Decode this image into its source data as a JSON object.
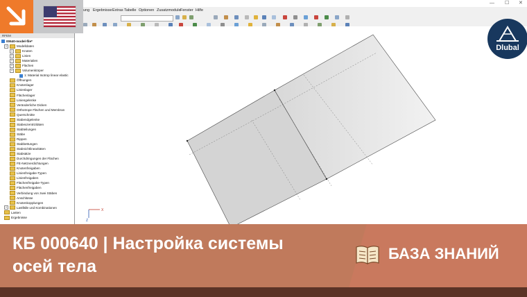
{
  "menu": [
    "ung",
    "Ergebnisse",
    "Extras",
    "Tabelle",
    "Optionen",
    "Zusatzmodule",
    "Fenster",
    "Hilfe"
  ],
  "window_controls": {
    "minimize": "—",
    "maximize": "☐",
    "close": "✕"
  },
  "navigator": {
    "header": "RFEM",
    "model": "00640-model-file*",
    "items": [
      {
        "label": "Modelldaten",
        "level": 1,
        "expand": true
      },
      {
        "label": "Knoten",
        "level": 2,
        "expand": true
      },
      {
        "label": "Linien",
        "level": 2,
        "expand": true
      },
      {
        "label": "Materialien",
        "level": 2,
        "expand": true
      },
      {
        "label": "Flächen",
        "level": 2,
        "expand": true
      },
      {
        "label": "Volumenkörper",
        "level": 2,
        "expand": true
      },
      {
        "label": "1: Material Isotrop linear elastic",
        "level": 3,
        "expand": false,
        "model": true
      },
      {
        "label": "Öffnungen",
        "level": 2
      },
      {
        "label": "Knotenlager",
        "level": 2
      },
      {
        "label": "Linienlager",
        "level": 2
      },
      {
        "label": "Flächenlager",
        "level": 2
      },
      {
        "label": "Liniengelenke",
        "level": 2
      },
      {
        "label": "Veränderliche Dicken",
        "level": 2
      },
      {
        "label": "Orthotrope Flächen und Membran",
        "level": 2
      },
      {
        "label": "Querschnitte",
        "level": 2
      },
      {
        "label": "Stabendgelenke",
        "level": 2
      },
      {
        "label": "Stabexzentrizitäten",
        "level": 2
      },
      {
        "label": "Stabteilungen",
        "level": 2
      },
      {
        "label": "Stäbe",
        "level": 2
      },
      {
        "label": "Rippen",
        "level": 2
      },
      {
        "label": "Stabbettungen",
        "level": 2
      },
      {
        "label": "Stabnichtlinearitäten",
        "level": 2
      },
      {
        "label": "Stabsätze",
        "level": 2
      },
      {
        "label": "Durchdringungen der Flächen",
        "level": 2
      },
      {
        "label": "FE-Netzverdichtungen",
        "level": 2
      },
      {
        "label": "Knotenfreigaben",
        "level": 2
      },
      {
        "label": "Linienfreigabe-Typen",
        "level": 2
      },
      {
        "label": "Linienfreigaben",
        "level": 2
      },
      {
        "label": "Flächenfreigabe-Typen",
        "level": 2
      },
      {
        "label": "Flächenfreigaben",
        "level": 2
      },
      {
        "label": "Verbindung von zwei Stäben",
        "level": 2
      },
      {
        "label": "Anschlüsse",
        "level": 2
      },
      {
        "label": "Knotenkopplungen",
        "level": 2
      },
      {
        "label": "Lastfälle und Kombinationen",
        "level": 1,
        "expand": true
      },
      {
        "label": "Lasten",
        "level": 1,
        "expand": false
      },
      {
        "label": "Ergebnisse",
        "level": 1,
        "expand": false
      }
    ]
  },
  "axis": {
    "x": "X",
    "z": "Z"
  },
  "logo": {
    "text": "Dlubal"
  },
  "banner": {
    "title_line1": "КБ 000640 | Настройка системы",
    "title_line2": "осей тела",
    "category": "БАЗА ЗНАНИЙ"
  },
  "colors": {
    "accent_orange": "#ef7a2a",
    "banner": "#c07a5c",
    "banner_dark": "#5b3326",
    "logo_bg": "#18385e"
  }
}
